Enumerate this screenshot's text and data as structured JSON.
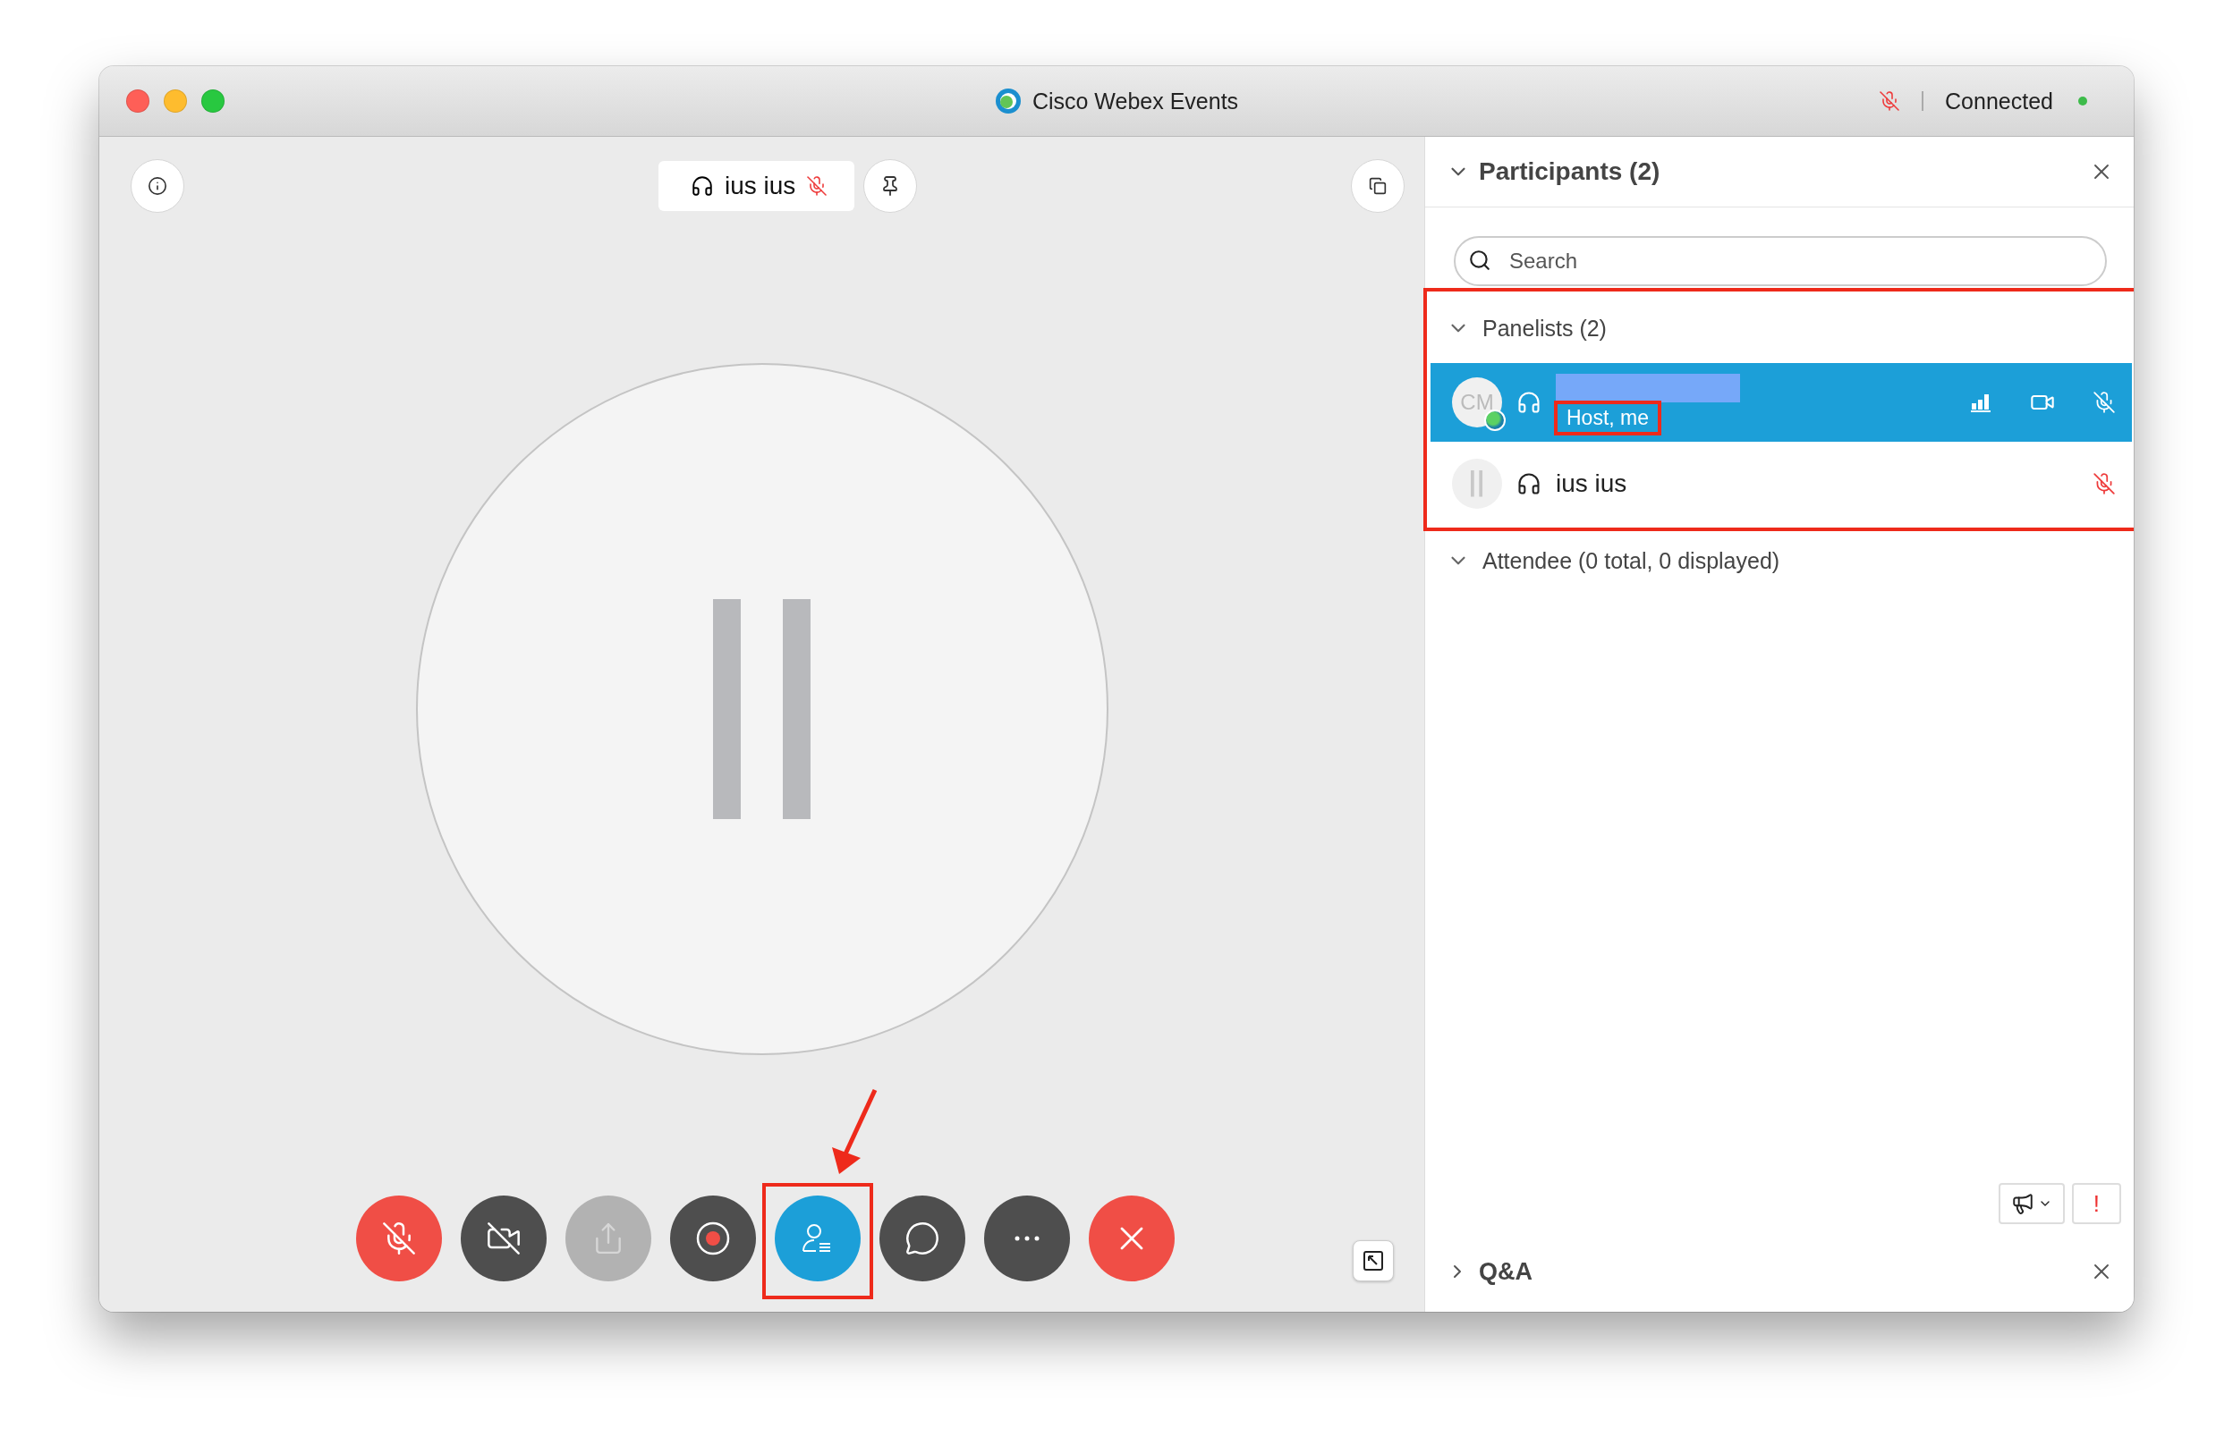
{
  "window": {
    "title": "Cisco Webex Events",
    "status": "Connected",
    "connected": true,
    "mic_muted": true
  },
  "stage": {
    "speaker": {
      "name": "ius ius",
      "muted": true
    },
    "paused": true
  },
  "toolbar": [
    {
      "kind": "mute",
      "selected": false,
      "disabled": false
    },
    {
      "kind": "video",
      "selected": false,
      "disabled": false
    },
    {
      "kind": "share",
      "selected": false,
      "disabled": true
    },
    {
      "kind": "record",
      "selected": false,
      "disabled": false
    },
    {
      "kind": "participants",
      "selected": true,
      "disabled": false,
      "highlighted": true
    },
    {
      "kind": "chat",
      "selected": false,
      "disabled": false
    },
    {
      "kind": "more",
      "selected": false,
      "disabled": false
    },
    {
      "kind": "leave",
      "selected": false,
      "disabled": false
    }
  ],
  "panel": {
    "title": "Participants (2)",
    "expanded": true,
    "search": {
      "placeholder": "Search"
    },
    "groups": [
      {
        "label": "Panelists (2)",
        "expanded": true,
        "highlighted": true,
        "members": [
          {
            "kind": "avatar",
            "initials": "CM",
            "role": "Host, me",
            "role_highlighted": true,
            "name_redacted": true,
            "selected": true,
            "muted": true
          },
          {
            "kind": "paused",
            "name": "ius ius",
            "selected": false,
            "muted": true
          }
        ]
      },
      {
        "label": "Attendee (0 total, 0 displayed)",
        "expanded": true,
        "highlighted": false
      }
    ],
    "alert_button": "!"
  },
  "qa": {
    "title": "Q&A",
    "expanded": false
  }
}
